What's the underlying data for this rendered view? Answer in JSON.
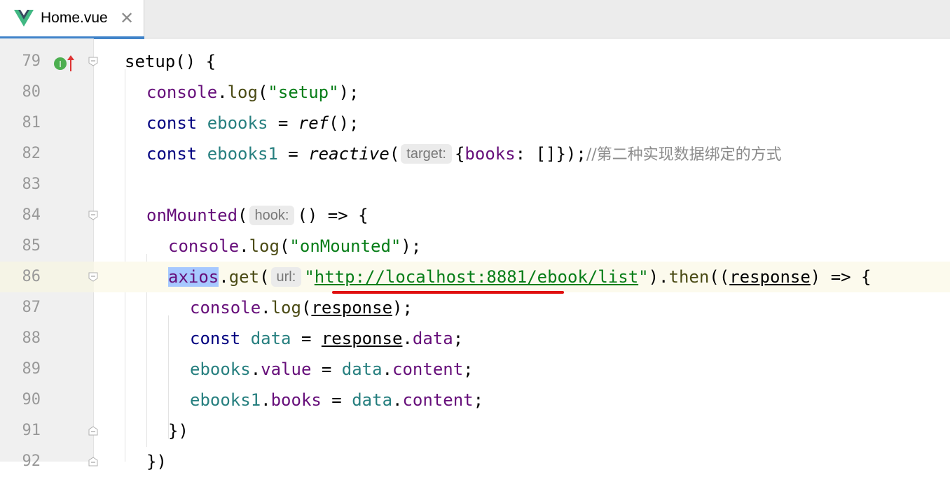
{
  "tab": {
    "title": "Home.vue",
    "close": "✕"
  },
  "hints": {
    "target": "target:",
    "hook": "hook:",
    "url": "url:"
  },
  "lines": [
    {
      "n": "79"
    },
    {
      "n": "80"
    },
    {
      "n": "81"
    },
    {
      "n": "82"
    },
    {
      "n": "83"
    },
    {
      "n": "84"
    },
    {
      "n": "85"
    },
    {
      "n": "86"
    },
    {
      "n": "87"
    },
    {
      "n": "88"
    },
    {
      "n": "89"
    },
    {
      "n": "90"
    },
    {
      "n": "91"
    },
    {
      "n": "92"
    }
  ],
  "code": {
    "l79": {
      "a": "setup() {"
    },
    "l80": {
      "fn": "console",
      "dot": ".",
      "m": "log",
      "p1": "(",
      "s": "\"setup\"",
      "p2": ");"
    },
    "l81": {
      "kw": "const",
      "v": "ebooks",
      "eq": " = ",
      "f": "ref",
      "rest": "();"
    },
    "l82": {
      "kw": "const",
      "v": "ebooks1",
      "eq": " = ",
      "f": "reactive",
      "p": "(",
      "obj1": "{",
      "prop": "books",
      "obj2": ": []});",
      "cmt": "//第二种实现数据绑定的方式"
    },
    "l84": {
      "f": "onMounted",
      "p": "(",
      "rest": "() => {"
    },
    "l85": {
      "fn": "console",
      "dot": ".",
      "m": "log",
      "p1": "(",
      "s": "\"onMounted\"",
      "p2": ");"
    },
    "l86": {
      "sel": "axios",
      "dot": ".",
      "m": "get",
      "p": "(",
      "q1": "\"",
      "url": "http://localhost:8881/ebook/list",
      "q2": "\"",
      "then": ").",
      "m2": "then",
      "p3": "((",
      "r": "response",
      "rest": ") => {"
    },
    "l87": {
      "fn": "console",
      "dot": ".",
      "m": "log",
      "p1": "(",
      "r": "response",
      "p2": ");"
    },
    "l88": {
      "kw": "const",
      "v": "data",
      "eq": " = ",
      "r": "response",
      "dot": ".",
      "prop": "data",
      "end": ";"
    },
    "l89": {
      "v": "ebooks",
      "dot": ".",
      "prop": "value",
      "eq": " = ",
      "v2": "data",
      "dot2": ".",
      "prop2": "content",
      "end": ";"
    },
    "l90": {
      "v": "ebooks1",
      "dot": ".",
      "prop": "books",
      "eq": " = ",
      "v2": "data",
      "dot2": ".",
      "prop2": "content",
      "end": ";"
    },
    "l91": {
      "a": "})"
    },
    "l92": {
      "a": "})"
    }
  },
  "colors": {
    "accent": "#4083c9",
    "keyword": "#000080",
    "string": "#067d17",
    "selection": "#a6c8ff",
    "error_underline": "#e01010"
  }
}
